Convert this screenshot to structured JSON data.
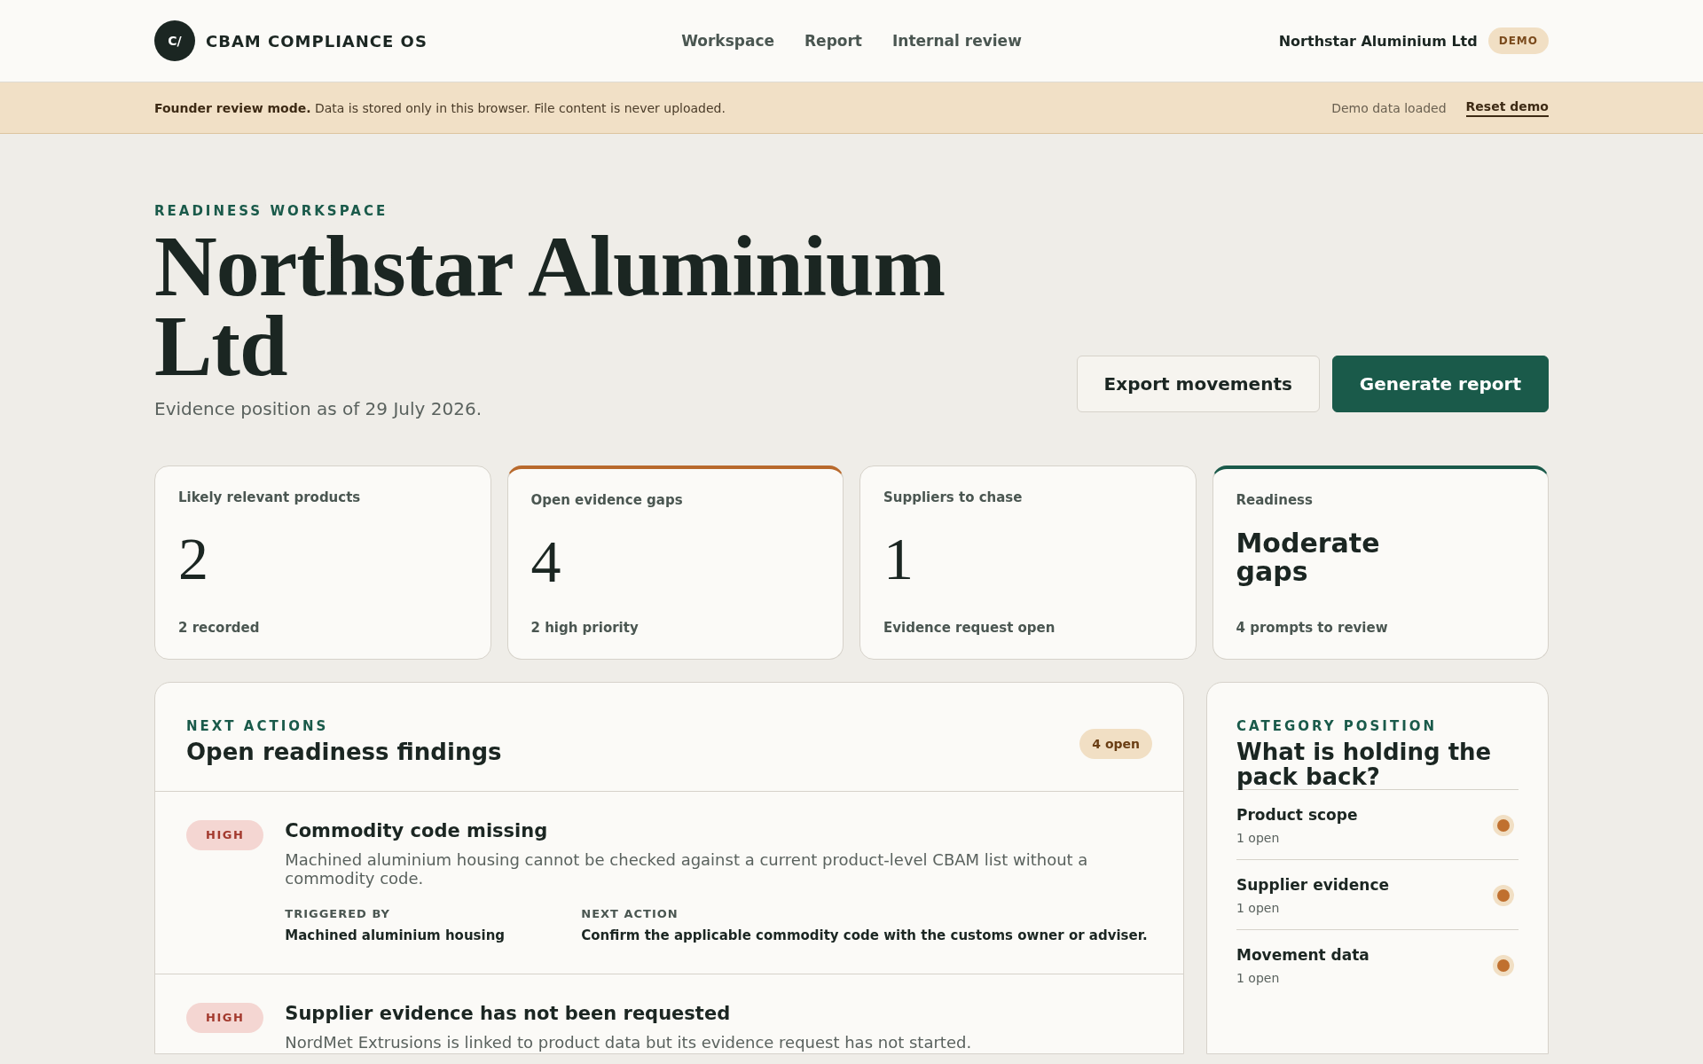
{
  "brand": {
    "logo": "C/",
    "name": "CBAM COMPLIANCE OS"
  },
  "nav": [
    {
      "label": "Workspace"
    },
    {
      "label": "Report"
    },
    {
      "label": "Internal review"
    }
  ],
  "account": {
    "company": "Northstar Aluminium Ltd",
    "badge": "DEMO"
  },
  "banner": {
    "text": "**Founder review mode.** Data is stored only in this browser. File content is never uploaded.",
    "status": "Demo data loaded",
    "link": "Reset demo"
  },
  "hero": {
    "eyebrow": "READINESS WORKSPACE",
    "title": "Northstar Aluminium Ltd",
    "subtitle": "Evidence position as of 29 July 2026.",
    "buttons": [
      {
        "label": "Export movements",
        "kind": "secondary"
      },
      {
        "label": "Generate report",
        "kind": "primary"
      }
    ]
  },
  "stats": [
    {
      "label": "Likely relevant products",
      "value": "2",
      "kind": "number",
      "note": "2 recorded"
    },
    {
      "label": "Open evidence gaps",
      "value": "4",
      "kind": "number",
      "note": "2 high priority",
      "color": "#b8692c"
    },
    {
      "label": "Suppliers to chase",
      "value": "1",
      "kind": "number",
      "note": "Evidence request open"
    },
    {
      "label": "Readiness",
      "value": "Moderate gaps",
      "kind": "text",
      "note": "4 prompts to review",
      "color": "#1a5a4a"
    }
  ],
  "findings": {
    "eyebrow": "NEXT ACTIONS",
    "title": "Open readiness findings",
    "count": "4 open",
    "items": [
      {
        "severity": "HIGH",
        "title": "Commodity code missing",
        "description": "Machined aluminium housing cannot be checked against a current product-level CBAM list without a commodity code.",
        "triggered_label": "TRIGGERED BY",
        "triggered": "Machined aluminium housing",
        "action_label": "NEXT ACTION",
        "action": "Confirm the applicable commodity code with the customs owner or adviser."
      },
      {
        "severity": "HIGH",
        "title": "Supplier evidence has not been requested",
        "description": "NordMet Extrusions is linked to product data but its evidence request has not started."
      }
    ]
  },
  "categories": {
    "eyebrow": "CATEGORY POSITION",
    "title": "What is holding the pack back?",
    "items": [
      {
        "name": "Product scope",
        "count": "1 open",
        "color": "#c0702f"
      },
      {
        "name": "Supplier evidence",
        "count": "1 open",
        "color": "#c0702f"
      },
      {
        "name": "Movement data",
        "count": "1 open",
        "color": "#c0702f"
      }
    ]
  }
}
